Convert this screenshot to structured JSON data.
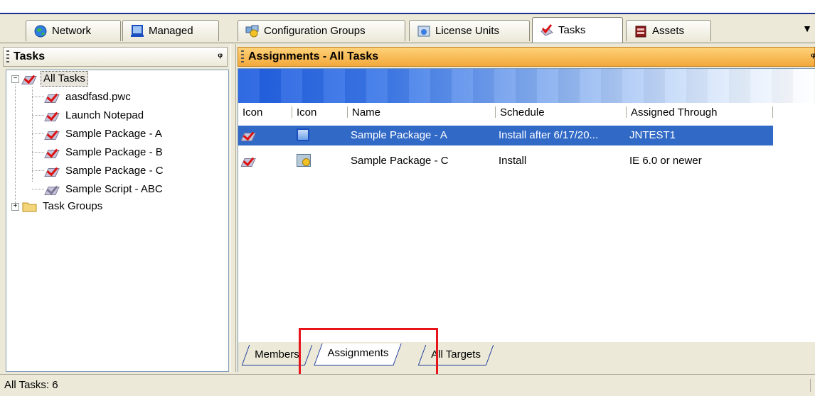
{
  "top_tabs": [
    {
      "label": "Network",
      "icon": "globe-icon"
    },
    {
      "label": "Managed",
      "icon": "computer-icon"
    },
    {
      "label": "Configuration Groups",
      "icon": "config-groups-icon"
    },
    {
      "label": "License Units",
      "icon": "license-icon"
    },
    {
      "label": "Tasks",
      "icon": "tasks-icon",
      "active": true
    },
    {
      "label": "Assets",
      "icon": "assets-icon"
    }
  ],
  "left_panel": {
    "title": "Tasks",
    "tree": {
      "root_label": "All Tasks",
      "children": [
        "aasdfasd.pwc",
        "Launch Notepad",
        "Sample Package - A",
        "Sample Package - B",
        "Sample Package - C",
        "Sample Script - ABC"
      ],
      "group_label": "Task Groups"
    }
  },
  "right_panel": {
    "title": "Assignments - All Tasks",
    "columns": [
      "Icon",
      "Icon",
      "Name",
      "Schedule",
      "Assigned Through"
    ],
    "rows": [
      {
        "name": "Sample Package - A",
        "schedule": "Install after 6/17/20...",
        "assigned": "JNTEST1",
        "selected": true
      },
      {
        "name": "Sample Package - C",
        "schedule": "Install",
        "assigned": "IE 6.0 or newer",
        "selected": false
      }
    ],
    "bottom_tabs": [
      {
        "label": "Members",
        "active": false
      },
      {
        "label": "Assignments",
        "active": true
      },
      {
        "label": "All Targets",
        "active": false
      }
    ]
  },
  "status_bar": {
    "text": "All Tasks: 6"
  },
  "colors": {
    "accent_header": "#f2a93b",
    "selection": "#3169c6",
    "highlight_box": "#e8141b"
  }
}
